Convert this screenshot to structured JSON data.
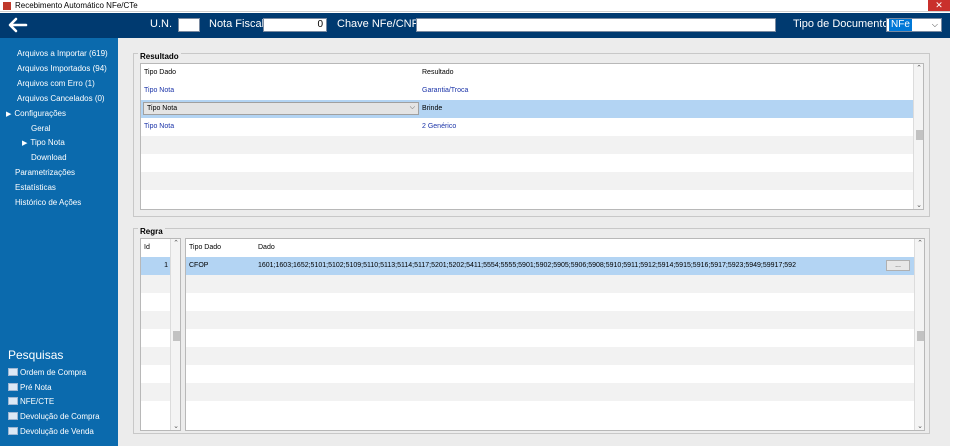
{
  "window": {
    "title": "Recebimento Automático NFe/CTe",
    "close_glyph": "✕"
  },
  "header": {
    "un_label": "U.N.",
    "un_value": "",
    "nota_label": "Nota Fiscal",
    "nota_value": "0",
    "chave_label": "Chave NFe/CNPJ",
    "chave_value": "",
    "tipo_doc_label": "Tipo de Documento",
    "tipo_doc_value": "NFe"
  },
  "sidebar": {
    "items": [
      "Arquivos a Importar (619)",
      "Arquivos Importados (94)",
      "Arquivos com Erro (1)",
      "Arquivos Cancelados (0)",
      "Configurações",
      "Geral",
      "Tipo Nota",
      "Download",
      "Parametrizações",
      "Estatísticas",
      "Histórico de Ações"
    ],
    "pesquisas_title": "Pesquisas",
    "pesquisas": [
      "Ordem de Compra",
      "Pré Nota",
      "NFE/CTE",
      "Devolução de Compra",
      "Devolução de Venda"
    ]
  },
  "resultado": {
    "label": "Resultado",
    "col_tipo": "Tipo Dado",
    "col_resultado": "Resultado",
    "rows": [
      {
        "tipo": "Tipo Nota",
        "resultado": "Garantia/Troca"
      },
      {
        "tipo": "Tipo Nota",
        "resultado": "Brinde"
      },
      {
        "tipo": "Tipo Nota",
        "resultado": "2 Genérico"
      }
    ]
  },
  "regra": {
    "label": "Regra",
    "col_id": "Id",
    "col_tipo": "Tipo Dado",
    "col_dado": "Dado",
    "rows": [
      {
        "id": "1",
        "tipo": "CFOP",
        "dado": "1601;1603;1652;5101;5102;5109;5110;5113;5114;5117;5201;5202;5411;5554;5555;5901;5902;5905;5906;5908;5910;5911;5912;5914;5915;5916;5917;5923;5949;59917;592",
        "button": "..."
      }
    ]
  },
  "colors": {
    "header_bg": "#003a70",
    "sidebar_bg": "#0b6aad",
    "selected_row": "#b3d4f3",
    "link_text": "#1a33a8"
  }
}
